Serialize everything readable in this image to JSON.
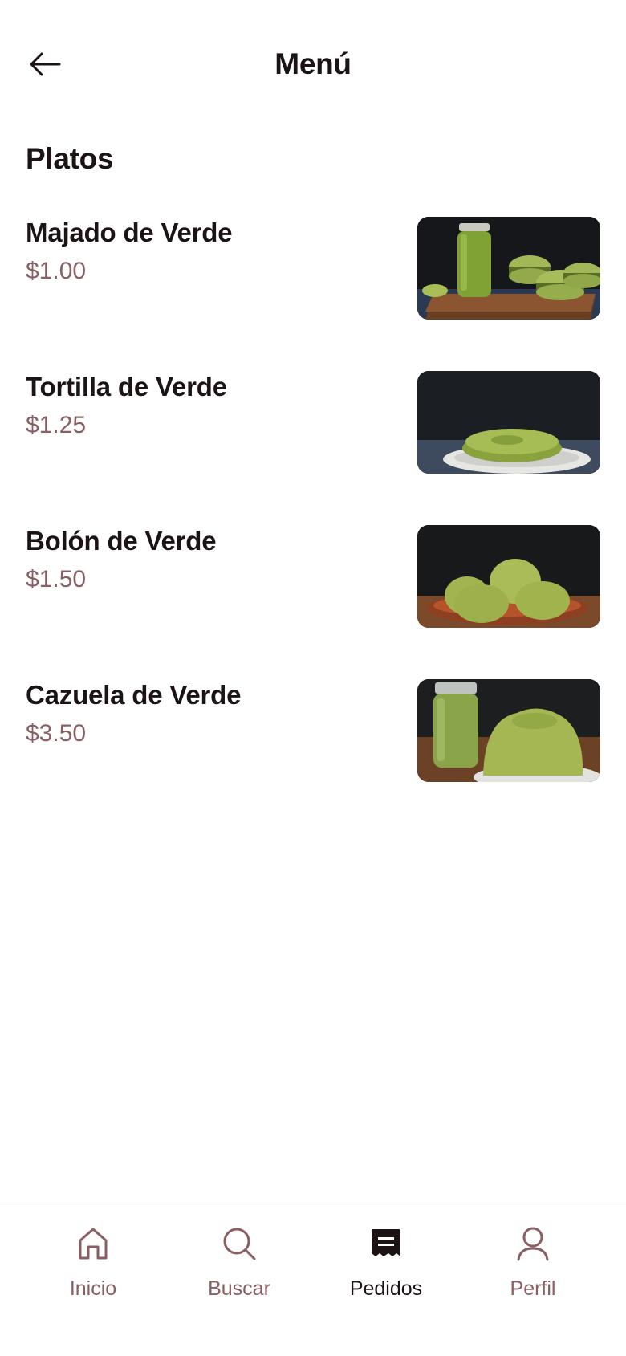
{
  "header": {
    "title": "Menú",
    "back_icon": "arrow-left-icon"
  },
  "section": {
    "title": "Platos"
  },
  "menu_items": [
    {
      "name": "Majado de Verde",
      "price": "$1.00",
      "image": "jar-and-green-balls-photo"
    },
    {
      "name": "Tortilla de Verde",
      "price": "$1.25",
      "image": "green-tortilla-plate-photo"
    },
    {
      "name": "Bolón de Verde",
      "price": "$1.50",
      "image": "green-balls-bowl-photo"
    },
    {
      "name": "Cazuela de Verde",
      "price": "$3.50",
      "image": "green-dome-plate-photo"
    }
  ],
  "bottom_nav": [
    {
      "label": "Inicio",
      "icon": "home-icon",
      "active": false
    },
    {
      "label": "Buscar",
      "icon": "search-icon",
      "active": false
    },
    {
      "label": "Pedidos",
      "icon": "receipt-icon",
      "active": true
    },
    {
      "label": "Perfil",
      "icon": "user-icon",
      "active": false
    }
  ],
  "colors": {
    "text_primary": "#1c1414",
    "text_secondary": "#8a5f63",
    "background": "#ffffff"
  }
}
